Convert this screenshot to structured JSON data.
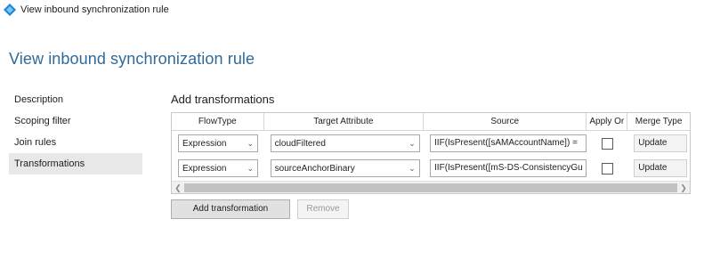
{
  "window": {
    "title": "View inbound synchronization rule"
  },
  "page": {
    "title": "View inbound synchronization rule"
  },
  "nav": {
    "items": [
      {
        "label": "Description",
        "selected": false
      },
      {
        "label": "Scoping filter",
        "selected": false
      },
      {
        "label": "Join rules",
        "selected": false
      },
      {
        "label": "Transformations",
        "selected": true
      }
    ]
  },
  "section": {
    "title": "Add transformations"
  },
  "grid": {
    "columns": [
      "FlowType",
      "Target Attribute",
      "Source",
      "Apply Or",
      "Merge Type"
    ],
    "rows": [
      {
        "flow_type": "Expression",
        "target": "cloudFiltered",
        "source": "IIF(IsPresent([sAMAccountName]) =",
        "apply_once": false,
        "merge_type": "Update"
      },
      {
        "flow_type": "Expression",
        "target": "sourceAnchorBinary",
        "source": "IIF(IsPresent([mS-DS-ConsistencyGu",
        "apply_once": false,
        "merge_type": "Update"
      }
    ]
  },
  "buttons": {
    "add_transformation": "Add transformation",
    "remove": "Remove"
  },
  "icons": {
    "app": "sync-diamond-icon",
    "dropdown": "chevron-down-icon"
  },
  "colors": {
    "title": "#2e6a9a",
    "app_icon": "#1e88d6"
  }
}
